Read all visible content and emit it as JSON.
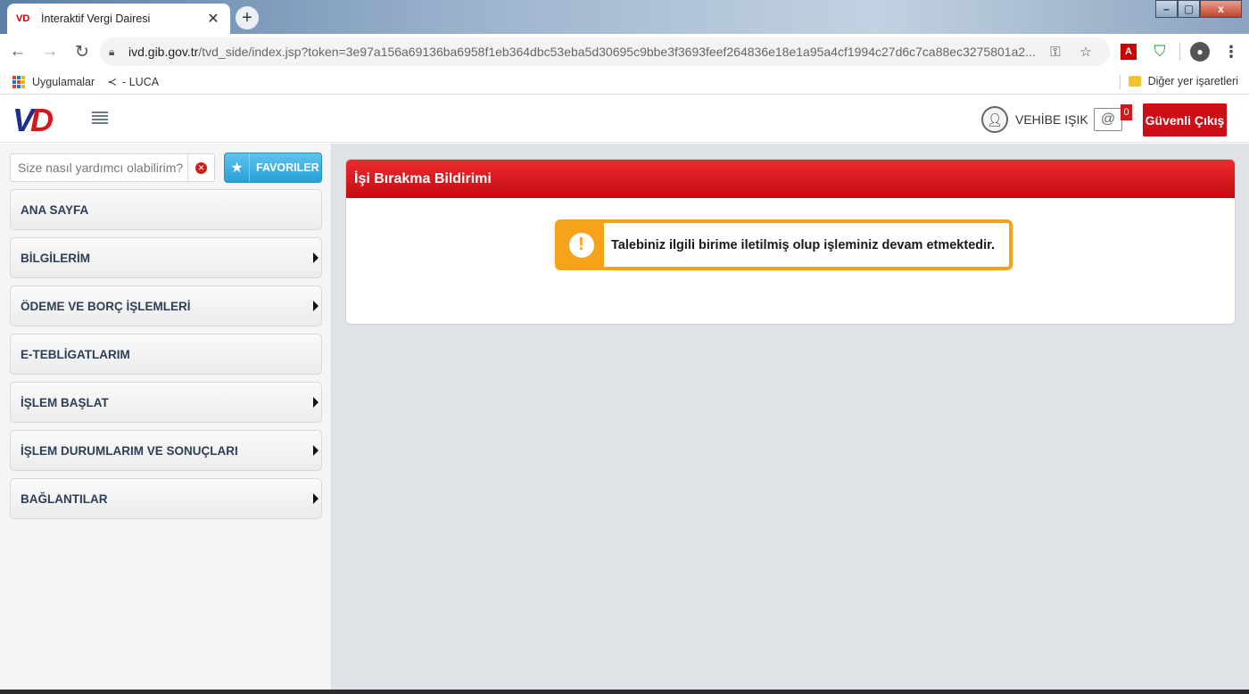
{
  "browser": {
    "tab_title": "İnteraktif Vergi Dairesi",
    "tab_favicon": "VD",
    "tab_close": "✕",
    "new_tab": "+",
    "url_host": "ivd.gib.gov.tr",
    "url_path": "/tvd_side/index.jsp?token=3e97a156a69136ba6958f1eb364dbc53eba5d30695c9bbe3f3693feef264836e18e1a95a4cf1994c27d6c7ca88ec3275801a2...",
    "window_min": "–",
    "window_max": "▢",
    "window_close": "x",
    "bookmarks": [
      {
        "label": "Uygulamalar",
        "icon": "apps-grid-icon"
      },
      {
        "label": "- LUCA",
        "icon": "share-icon"
      }
    ],
    "other_bookmarks": "Diğer yer işaretleri"
  },
  "header": {
    "logo_v": "V",
    "logo_d": "D",
    "user_name": "VEHİBE IŞIK",
    "mail_count": "0",
    "logout_label": "Güvenli Çıkış"
  },
  "sidebar": {
    "search_placeholder": "Size nasıl yardımcı olabilirim?",
    "favorites_label": "FAVORILER",
    "items": [
      {
        "label": "ANA SAYFA",
        "has_arrow": false
      },
      {
        "label": "BİLGİLERİM",
        "has_arrow": true
      },
      {
        "label": "ÖDEME VE BORÇ İŞLEMLERİ",
        "has_arrow": true
      },
      {
        "label": "E-TEBLİGATLARIM",
        "has_arrow": false
      },
      {
        "label": "İŞLEM BAŞLAT",
        "has_arrow": true
      },
      {
        "label": "İŞLEM DURUMLARIM VE SONUÇLARI",
        "has_arrow": true
      },
      {
        "label": "BAĞLANTILAR",
        "has_arrow": true
      }
    ]
  },
  "main": {
    "panel_title": "İşi Bırakma Bildirimi",
    "alert_message": "Talebiniz ilgili birime iletilmiş olup işleminiz devam etmektedir.",
    "alert_icon_glyph": "!"
  },
  "colors": {
    "brand_red": "#cc0f17",
    "alert_orange": "#f6a21b",
    "favorites_blue": "#2a9fd6",
    "menu_text": "#2d3e57"
  }
}
